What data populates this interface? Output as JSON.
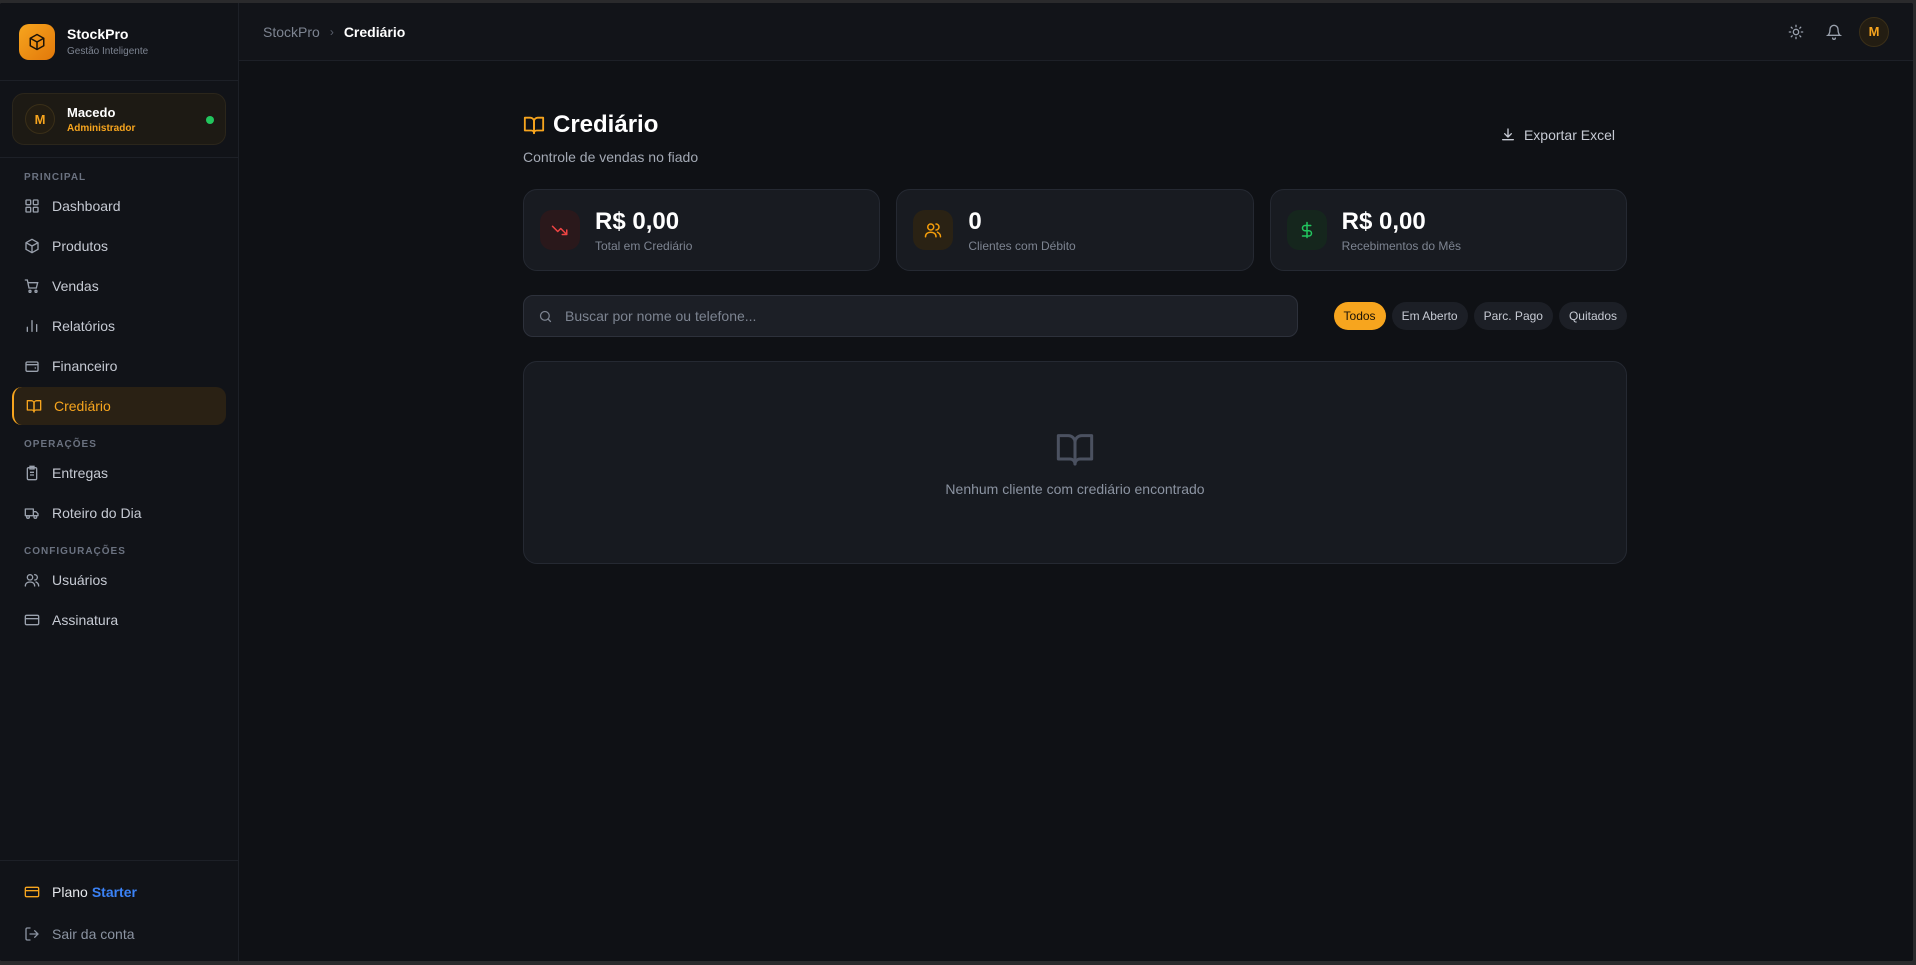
{
  "brand": {
    "name": "StockPro",
    "tagline": "Gestão Inteligente"
  },
  "user": {
    "initial": "M",
    "name": "Macedo",
    "role": "Administrador",
    "status_color": "#22c55e"
  },
  "sections": {
    "principal": "PRINCIPAL",
    "operacoes": "OPERAÇÕES",
    "configuracoes": "CONFIGURAÇÕES"
  },
  "nav": {
    "dashboard": "Dashboard",
    "produtos": "Produtos",
    "vendas": "Vendas",
    "relatorios": "Relatórios",
    "financeiro": "Financeiro",
    "crediario": "Crediário",
    "entregas": "Entregas",
    "roteiro": "Roteiro do Dia",
    "usuarios": "Usuários",
    "assinatura": "Assinatura"
  },
  "plan": {
    "label": "Plano",
    "name": "Starter"
  },
  "logout": "Sair da conta",
  "breadcrumb": {
    "root": "StockPro",
    "current": "Crediário"
  },
  "topbar": {
    "avatar_initial": "M"
  },
  "page": {
    "title": "Crediário",
    "subtitle": "Controle de vendas no fiado",
    "export_label": "Exportar Excel"
  },
  "stats": [
    {
      "value": "R$ 0,00",
      "label": "Total em Crediário",
      "icon": "trending-down-icon",
      "color": "#ef4444"
    },
    {
      "value": "0",
      "label": "Clientes com Débito",
      "icon": "users-icon",
      "color": "#f59e0b"
    },
    {
      "value": "R$ 0,00",
      "label": "Recebimentos do Mês",
      "icon": "dollar-icon",
      "color": "#22c55e"
    }
  ],
  "search": {
    "placeholder": "Buscar por nome ou telefone...",
    "value": ""
  },
  "filters": [
    "Todos",
    "Em Aberto",
    "Parc. Pago",
    "Quitados"
  ],
  "empty_state": "Nenhum cliente com crediário encontrado",
  "colors": {
    "accent": "#f7a51e",
    "plan": "#3b82f6",
    "background": "#0f1115"
  }
}
